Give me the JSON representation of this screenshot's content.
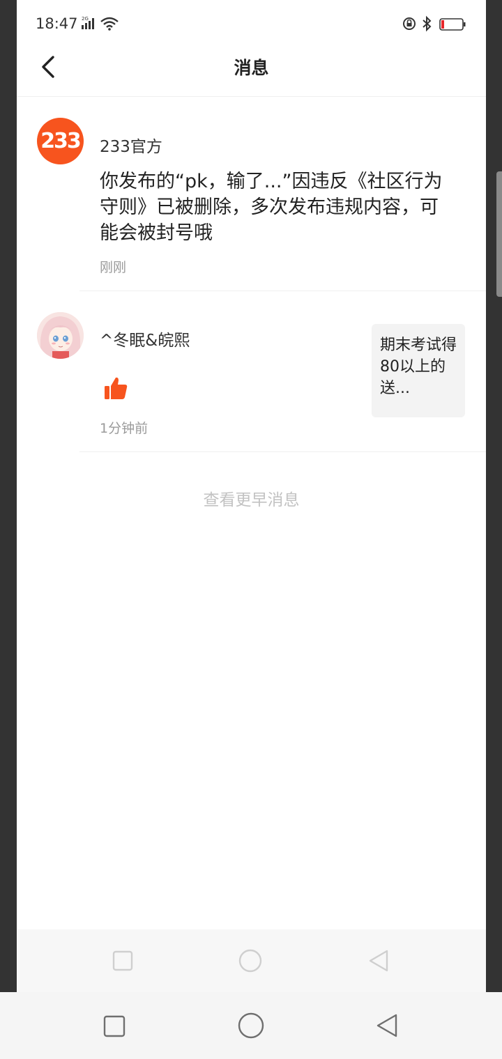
{
  "status_bar": {
    "time": "18:47",
    "signal_label": "2G",
    "icons": [
      "signal-icon",
      "wifi-icon",
      "lock-rotation-icon",
      "bluetooth-icon",
      "battery-icon"
    ]
  },
  "header": {
    "title": "消息",
    "back_icon": "back-arrow-icon"
  },
  "messages": [
    {
      "avatar_text": "233",
      "sender": "233官方",
      "body": "你发布的“pk，输了...”因违反《社区行为守则》已被删除，多次发布违规内容，可能会被封号哦",
      "time": "刚刚"
    },
    {
      "avatar": "anime-girl-avatar",
      "sender": "^冬眠&皖熙",
      "action_icon": "thumbs-up-icon",
      "time": "1分钟前",
      "preview": "期末考试得80以上的送..."
    }
  ],
  "load_more": "查看更早消息",
  "colors": {
    "accent": "#f7541e",
    "text_primary": "#222222",
    "text_secondary": "#9a9a9a",
    "link_muted": "#c2c2c2"
  },
  "nav_bar": {
    "icons": [
      "recent-apps-icon",
      "home-icon",
      "back-icon"
    ]
  }
}
